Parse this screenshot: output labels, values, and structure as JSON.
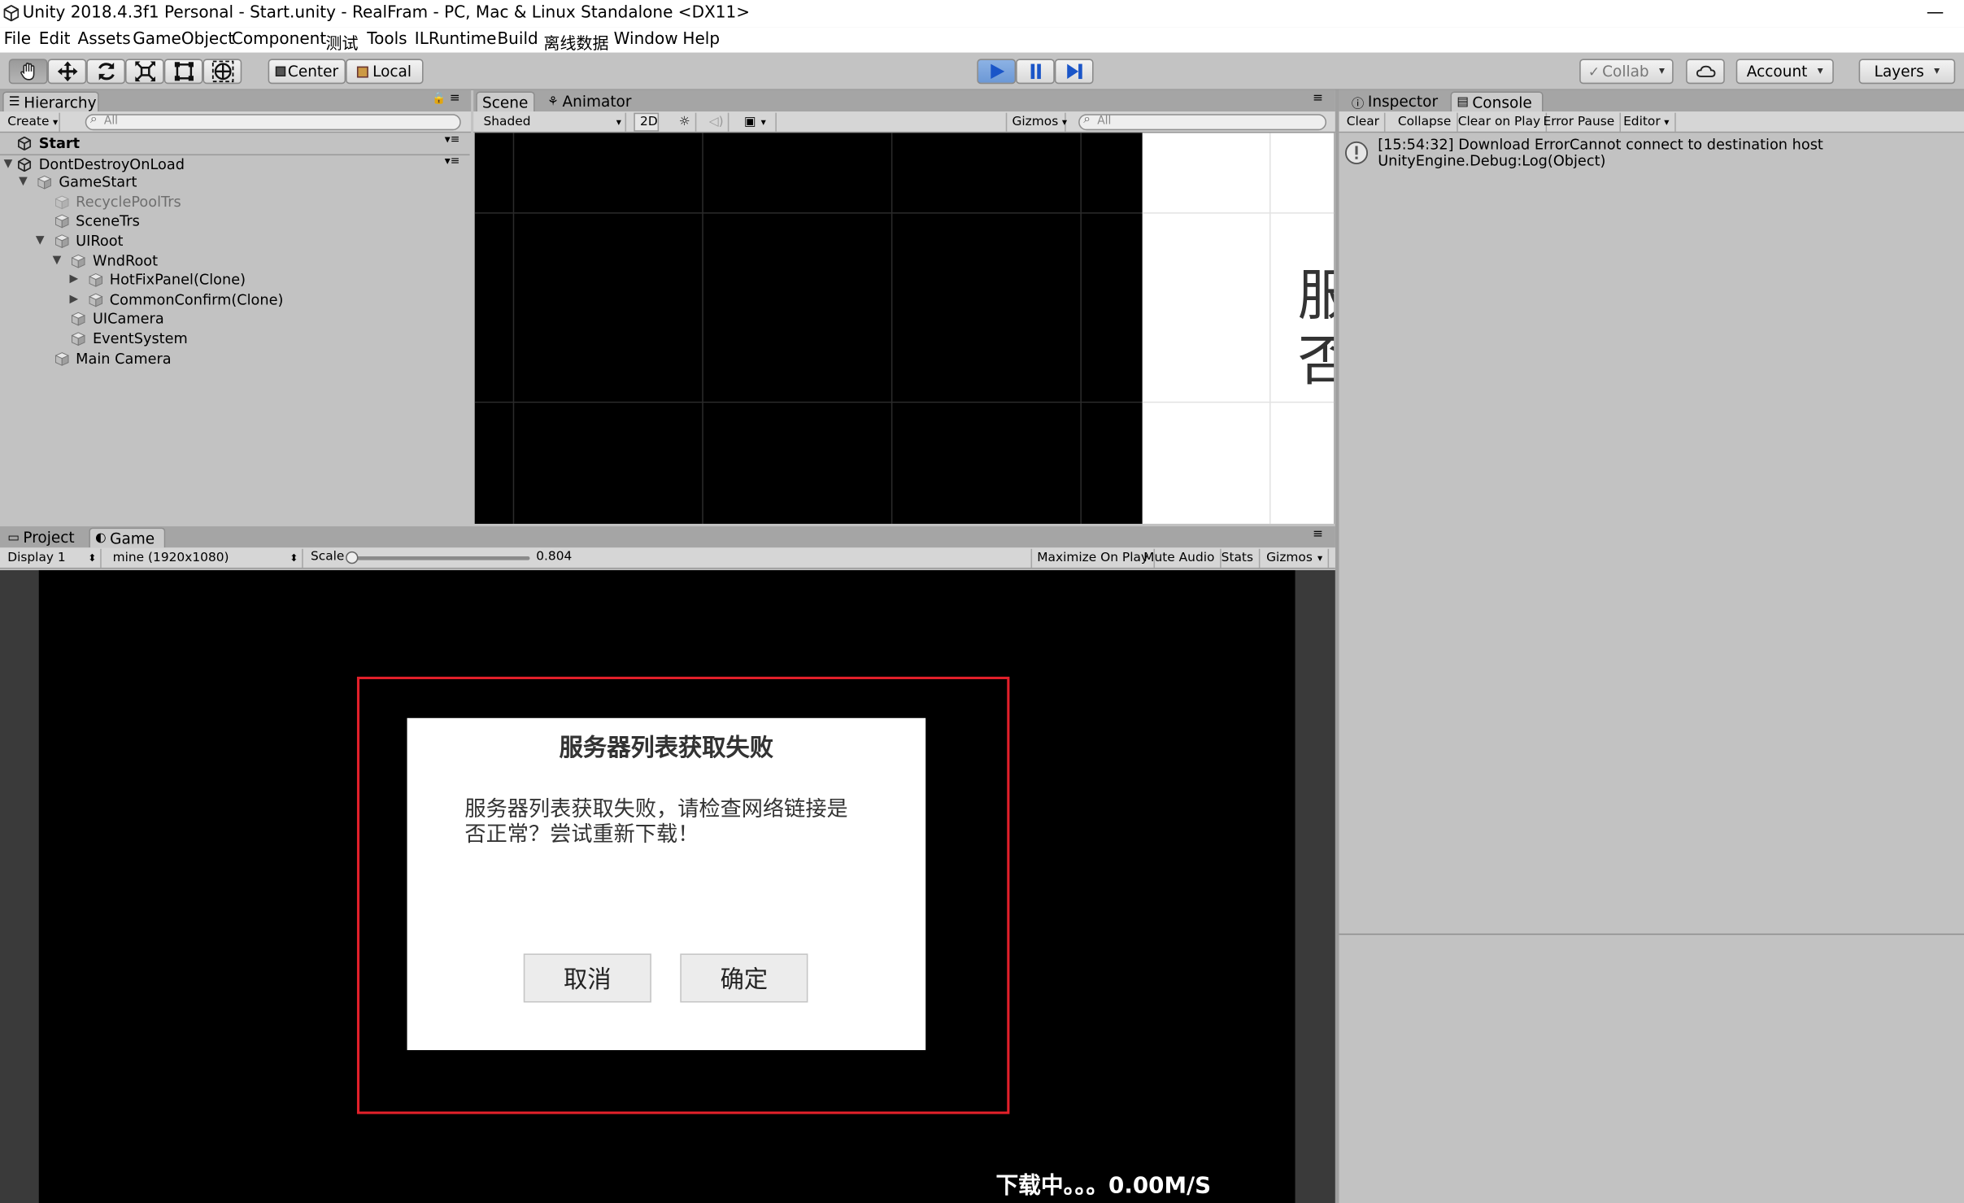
{
  "window": {
    "title": "Unity 2018.4.3f1 Personal - Start.unity - RealFram - PC, Mac & Linux Standalone <DX11>",
    "minimize_glyph": "—"
  },
  "menu": [
    "File",
    "Edit",
    "Assets",
    "GameObject",
    "Component",
    "测试",
    "Tools",
    "ILRuntime",
    "Build",
    "离线数据",
    "Window",
    "Help"
  ],
  "toolbar": {
    "tools": [
      "hand-icon",
      "move-icon",
      "rotate-icon",
      "scale-icon",
      "rect-icon",
      "transform-icon"
    ],
    "pivot_label": "Center",
    "space_label": "Local",
    "play_icons": [
      "play-icon",
      "pause-icon",
      "step-icon"
    ],
    "collab_label": "Collab",
    "account_label": "Account",
    "layers_label": "Layers"
  },
  "hierarchy": {
    "tab_label": "Hierarchy",
    "create_label": "Create",
    "search_placeholder": "All",
    "items": [
      {
        "label": "Start",
        "depth": 0,
        "type": "scene",
        "bold": true
      },
      {
        "label": "DontDestroyOnLoad",
        "depth": 0,
        "type": "scene",
        "expanded": true
      },
      {
        "label": "GameStart",
        "depth": 1,
        "expanded": true
      },
      {
        "label": "RecyclePoolTrs",
        "depth": 2,
        "inactive": true
      },
      {
        "label": "SceneTrs",
        "depth": 2
      },
      {
        "label": "UIRoot",
        "depth": 2,
        "expanded": true
      },
      {
        "label": "WndRoot",
        "depth": 3,
        "expanded": true
      },
      {
        "label": "HotFixPanel(Clone)",
        "depth": 4,
        "collapsed": true
      },
      {
        "label": "CommonConfirm(Clone)",
        "depth": 4,
        "collapsed": true
      },
      {
        "label": "UICamera",
        "depth": 3
      },
      {
        "label": "EventSystem",
        "depth": 3
      },
      {
        "label": "Main Camera",
        "depth": 2
      }
    ]
  },
  "scene": {
    "tabs": [
      "Scene",
      "Animator"
    ],
    "shading_label": "Shaded",
    "mode_2d_label": "2D",
    "gizmos_label": "Gizmos",
    "search_placeholder": "All",
    "preview_text_top": "服",
    "preview_text_bottom": "否"
  },
  "inspector": {
    "tabs": [
      "Inspector",
      "Console"
    ],
    "buttons": [
      "Clear",
      "Collapse",
      "Clear on Play",
      "Error Pause",
      "Editor"
    ],
    "log_line1": "[15:54:32] Download ErrorCannot connect to destination host",
    "log_line2": "UnityEngine.Debug:Log(Object)"
  },
  "bottom": {
    "tabs": [
      "Project",
      "Game"
    ],
    "display_label": "Display 1",
    "resolution_label": "mine (1920x1080)",
    "scale_label": "Scale",
    "scale_value": "0.804",
    "scale_fraction": 0.02,
    "buttons": [
      "Maximize On Play",
      "Mute Audio",
      "Stats",
      "Gizmos"
    ]
  },
  "game": {
    "dialog_title": "服务器列表获取失败",
    "dialog_message_line1": "服务器列表获取失败，请检查网络链接是",
    "dialog_message_line2": "否正常？尝试重新下载！",
    "cancel_label": "取消",
    "ok_label": "确定",
    "download_status": "下载中。。。0.00M/S"
  }
}
